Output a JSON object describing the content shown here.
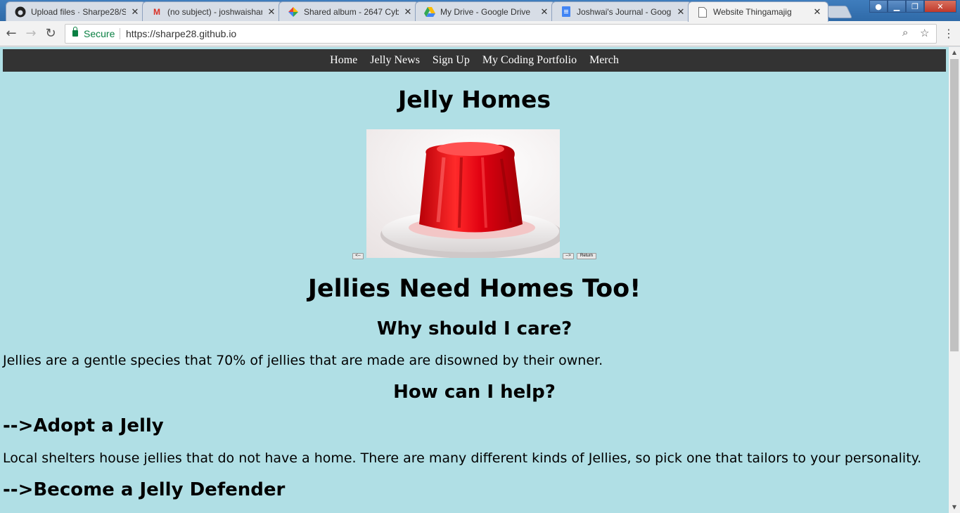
{
  "browser": {
    "tabs": [
      {
        "title": "Upload files · Sharpe28/S",
        "icon": "github-icon"
      },
      {
        "title": "(no subject) - joshwaishar",
        "icon": "gmail-icon"
      },
      {
        "title": "Shared album - 2647 Cyb",
        "icon": "photos-icon"
      },
      {
        "title": "My Drive - Google Drive",
        "icon": "drive-icon"
      },
      {
        "title": "Joshwai's Journal - Googl",
        "icon": "docs-icon"
      },
      {
        "title": "Website Thingamajig",
        "icon": "page-icon"
      }
    ],
    "active_tab": 5,
    "secure_label": "Secure",
    "url": "https://sharpe28.github.io"
  },
  "site": {
    "nav": [
      "Home",
      "Jelly News",
      "Sign Up",
      "My Coding Portfolio",
      "Merch"
    ],
    "title": "Jelly Homes",
    "slideshow": {
      "prev_label": "<--",
      "next_label": "-->",
      "return_label": "Return"
    },
    "heading": "Jellies Need Homes Too!",
    "why_heading": "Why should I care?",
    "why_text": "Jellies are a gentle species that 70% of jellies that are made are disowned by their owner.",
    "help_heading": "How can I help?",
    "adopt_heading": "-->Adopt a Jelly",
    "adopt_text": "Local shelters house jellies that do not have a home. There are many different kinds of Jellies, so pick one that tailors to your personality.",
    "defender_heading": "-->Become a Jelly Defender"
  },
  "colors": {
    "page_bg": "#b0dfe5",
    "nav_bg": "#333333",
    "secure": "#0b8043"
  }
}
